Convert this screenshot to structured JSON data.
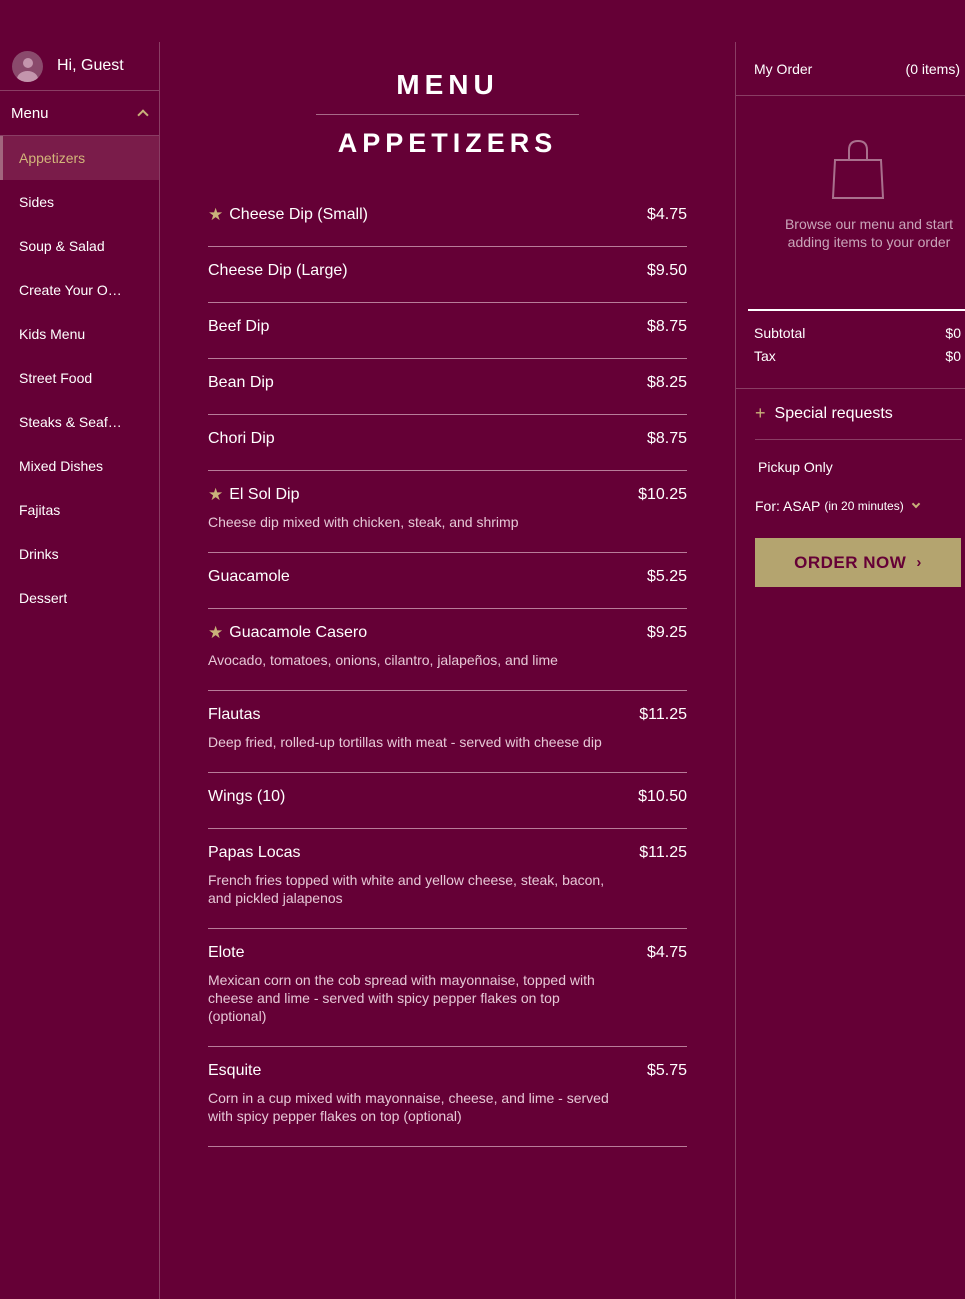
{
  "user": {
    "greeting": "Hi, Guest"
  },
  "sidebar": {
    "menu_label": "Menu",
    "categories": [
      {
        "label": "Appetizers",
        "active": true
      },
      {
        "label": "Sides"
      },
      {
        "label": "Soup & Salad"
      },
      {
        "label": "Create Your Own Combination"
      },
      {
        "label": "Kids Menu"
      },
      {
        "label": "Street Food"
      },
      {
        "label": "Steaks & Seafood"
      },
      {
        "label": "Mixed Dishes"
      },
      {
        "label": "Fajitas"
      },
      {
        "label": "Drinks"
      },
      {
        "label": "Dessert"
      }
    ]
  },
  "main": {
    "title": "MENU",
    "section_title": "APPETIZERS",
    "items": [
      {
        "name": "Cheese Dip (Small)",
        "price": "$4.75",
        "featured": true,
        "desc": ""
      },
      {
        "name": "Cheese Dip (Large)",
        "price": "$9.50",
        "featured": false,
        "desc": ""
      },
      {
        "name": "Beef Dip",
        "price": "$8.75",
        "featured": false,
        "desc": ""
      },
      {
        "name": "Bean Dip",
        "price": "$8.25",
        "featured": false,
        "desc": ""
      },
      {
        "name": "Chori Dip",
        "price": "$8.75",
        "featured": false,
        "desc": ""
      },
      {
        "name": "El Sol Dip",
        "price": "$10.25",
        "featured": true,
        "desc": "Cheese dip mixed with chicken, steak, and shrimp"
      },
      {
        "name": "Guacamole",
        "price": "$5.25",
        "featured": false,
        "desc": ""
      },
      {
        "name": "Guacamole Casero",
        "price": "$9.25",
        "featured": true,
        "desc": "Avocado, tomatoes, onions, cilantro, jalapeños, and lime"
      },
      {
        "name": "Flautas",
        "price": "$11.25",
        "featured": false,
        "desc": "Deep fried, rolled-up tortillas with meat - served with cheese dip"
      },
      {
        "name": "Wings (10)",
        "price": "$10.50",
        "featured": false,
        "desc": ""
      },
      {
        "name": "Papas Locas",
        "price": "$11.25",
        "featured": false,
        "desc": "French fries topped with white and yellow cheese, steak, bacon, and pickled jalapenos"
      },
      {
        "name": "Elote",
        "price": "$4.75",
        "featured": false,
        "desc": "Mexican corn on the cob spread with mayonnaise, topped with cheese and lime - served with spicy pepper flakes on top (optional)"
      },
      {
        "name": "Esquite",
        "price": "$5.75",
        "featured": false,
        "desc": "Corn in a cup mixed with mayonnaise, cheese, and lime - served with spicy pepper flakes on top (optional)"
      }
    ]
  },
  "order": {
    "title": "My Order",
    "count": "(0 items)",
    "empty_text": "Browse our menu and start adding items to your order",
    "subtotal_label": "Subtotal",
    "subtotal_value": "$0",
    "tax_label": "Tax",
    "tax_value": "$0",
    "special_requests": "Special requests",
    "pickup": "Pickup Only",
    "time_prefix": "For: ASAP",
    "time_detail": "(in 20 minutes)",
    "order_button": "ORDER NOW"
  },
  "colors": {
    "background": "#650036",
    "accent_gold": "#c9b27a",
    "button": "#b4a46f",
    "active_item": "#7a1c4a"
  },
  "icons": {
    "avatar": "user-avatar-icon",
    "menu_toggle": "chevron-up-icon",
    "featured": "star-icon",
    "bag": "shopping-bag-icon",
    "special": "plus-icon",
    "time": "chevron-down-icon",
    "button": "chevron-right-icon"
  }
}
